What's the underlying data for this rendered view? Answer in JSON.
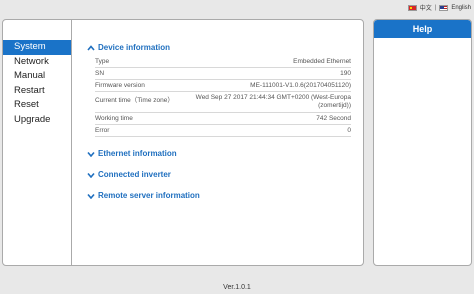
{
  "lang": {
    "chinese": "中文",
    "separator": "|",
    "english": "English"
  },
  "sidebar": {
    "items": [
      {
        "label": "System"
      },
      {
        "label": "Network"
      },
      {
        "label": "Manual"
      },
      {
        "label": "Restart"
      },
      {
        "label": "Reset"
      },
      {
        "label": "Upgrade"
      }
    ]
  },
  "device_info": {
    "title": "Device information",
    "rows": [
      {
        "label": "Type",
        "value": "Embedded Ethernet"
      },
      {
        "label": "SN",
        "value": "190"
      },
      {
        "label": "Firmware version",
        "value": "ME-111001-V1.0.6(201704051120)"
      },
      {
        "label": "Current time（Time zone）",
        "value": "Wed Sep 27 2017 21:44:34 GMT+0200 (West-Europa (zomertijd))"
      },
      {
        "label": "Working time",
        "value": "742 Second"
      },
      {
        "label": "Error",
        "value": "0"
      }
    ]
  },
  "sections": {
    "ethernet": "Ethernet information",
    "inverter": "Connected inverter",
    "remote": "Remote server information"
  },
  "help": {
    "title": "Help"
  },
  "footer": {
    "version": "Ver.1.0.1"
  },
  "colors": {
    "accent": "#1a73c8",
    "section_title": "#1f6fbf"
  }
}
